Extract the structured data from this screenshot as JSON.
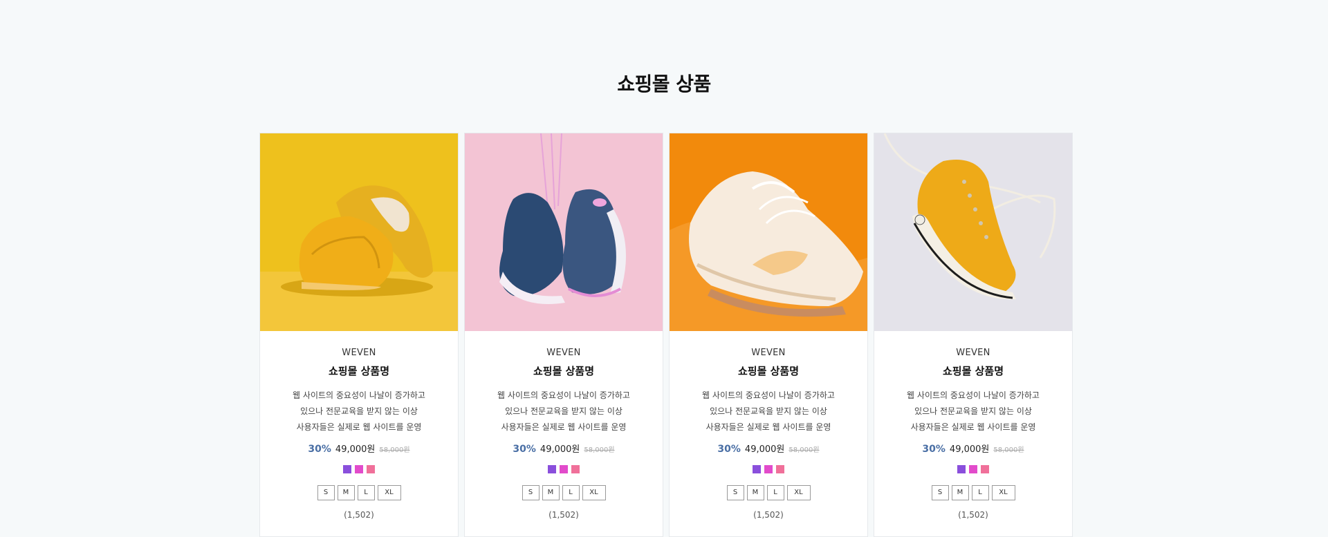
{
  "section": {
    "title": "쇼핑몰 상품"
  },
  "products": [
    {
      "brand": "WEVEN",
      "name": "쇼핑몰 상품명",
      "description_lines": [
        "웹 사이트의 중요성이 나날이 증가하고",
        "있으나 전문교육을 받지 않는 이상",
        "사용자들은 실제로 웹 사이트를 운영"
      ],
      "discount": "30%",
      "price": "49,000원",
      "original_price": "58,000원",
      "colors": [
        "#8a4fdc",
        "#e24bcb",
        "#f0709a"
      ],
      "sizes": [
        "S",
        "M",
        "L",
        "XL"
      ],
      "reviews": "(1,502)",
      "image": "yellow-sneakers-photo",
      "image_bg": "#eec11d"
    },
    {
      "brand": "WEVEN",
      "name": "쇼핑몰 상품명",
      "description_lines": [
        "웹 사이트의 중요성이 나날이 증가하고",
        "있으나 전문교육을 받지 않는 이상",
        "사용자들은 실제로 웹 사이트를 운영"
      ],
      "discount": "30%",
      "price": "49,000원",
      "original_price": "58,000원",
      "colors": [
        "#8a4fdc",
        "#e24bcb",
        "#f0709a"
      ],
      "sizes": [
        "S",
        "M",
        "L",
        "XL"
      ],
      "reviews": "(1,502)",
      "image": "hanging-navy-sneakers-photo",
      "image_bg": "#f3c4d4"
    },
    {
      "brand": "WEVEN",
      "name": "쇼핑몰 상품명",
      "description_lines": [
        "웹 사이트의 중요성이 나날이 증가하고",
        "있으나 전문교육을 받지 않는 이상",
        "사용자들은 실제로 웹 사이트를 운영"
      ],
      "discount": "30%",
      "price": "49,000원",
      "original_price": "58,000원",
      "colors": [
        "#8a4fdc",
        "#e24bcb",
        "#f0709a"
      ],
      "sizes": [
        "S",
        "M",
        "L",
        "XL"
      ],
      "reviews": "(1,502)",
      "image": "white-sneaker-orange-bg-photo",
      "image_bg": "#f28a0c"
    },
    {
      "brand": "WEVEN",
      "name": "쇼핑몰 상품명",
      "description_lines": [
        "웹 사이트의 중요성이 나날이 증가하고",
        "있으나 전문교육을 받지 않는 이상",
        "사용자들은 실제로 웹 사이트를 운영"
      ],
      "discount": "30%",
      "price": "49,000원",
      "original_price": "58,000원",
      "colors": [
        "#8a4fdc",
        "#e24bcb",
        "#f0709a"
      ],
      "sizes": [
        "S",
        "M",
        "L",
        "XL"
      ],
      "reviews": "(1,502)",
      "image": "yellow-hightop-sneaker-photo",
      "image_bg": "#e4e3ea"
    }
  ]
}
